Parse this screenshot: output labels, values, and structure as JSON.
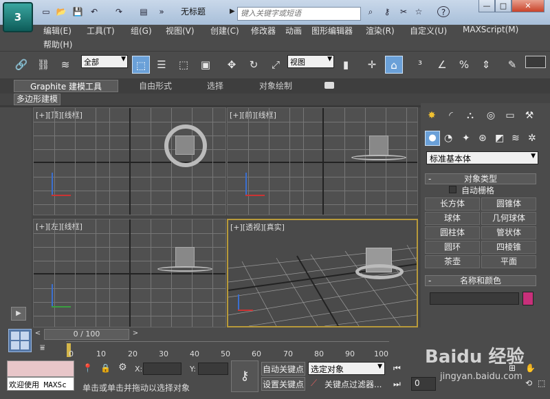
{
  "app": {
    "title": "无标题",
    "logo_text": "3",
    "search_placeholder": "键入关键字或短语"
  },
  "quick_access": [
    "new-file-icon",
    "open-folder-icon",
    "save-icon",
    "undo-icon",
    "redo-icon",
    "project-icon",
    "more-icon"
  ],
  "window_buttons": [
    "—",
    "□",
    "✕"
  ],
  "menu": {
    "row1": [
      "编辑(E)",
      "工具(T)",
      "组(G)",
      "视图(V)",
      "创建(C)",
      "修改器",
      "动画",
      "图形编辑器",
      "渲染(R)",
      "自定义(U)",
      "MAXScript(M)"
    ],
    "row2": [
      "帮助(H)"
    ]
  },
  "toolbar": {
    "selection_filter": "全部",
    "reference_coord": "视图"
  },
  "ribbon": {
    "tabs": [
      "Graphite 建模工具",
      "自由形式",
      "选择",
      "对象绘制"
    ],
    "panel": "多边形建模"
  },
  "viewports": [
    {
      "label": "[+][顶][线框]"
    },
    {
      "label": "[+][前][线框]"
    },
    {
      "label": "[+][左][线框]"
    },
    {
      "label": "[+][透视][真实]"
    }
  ],
  "command_panel": {
    "category": "标准基本体",
    "object_type_title": "对象类型",
    "autogrid_label": "自动栅格",
    "buttons": [
      "长方体",
      "圆锥体",
      "球体",
      "几何球体",
      "圆柱体",
      "管状体",
      "圆环",
      "四棱锥",
      "茶壶",
      "平面"
    ],
    "name_color_title": "名称和颜色",
    "color": "#c8307a"
  },
  "timeline": {
    "frame_display": "0 / 100",
    "ticks": [
      "0",
      "10",
      "20",
      "30",
      "40",
      "50",
      "60",
      "70",
      "80",
      "90",
      "100"
    ]
  },
  "status": {
    "welcome": "欢迎使用 MAXSc",
    "prompt": "单击或单击并拖动以选择对象",
    "x_label": "X:",
    "y_label": "Y:",
    "auto_key": "自动关键点",
    "set_key": "设置关键点",
    "key_mode": "选定对象",
    "key_filter": "关键点过滤器...",
    "frame_value": "0"
  },
  "watermark": {
    "text": "Baidu 经验",
    "subtext": "jingyan.baidu.com"
  }
}
